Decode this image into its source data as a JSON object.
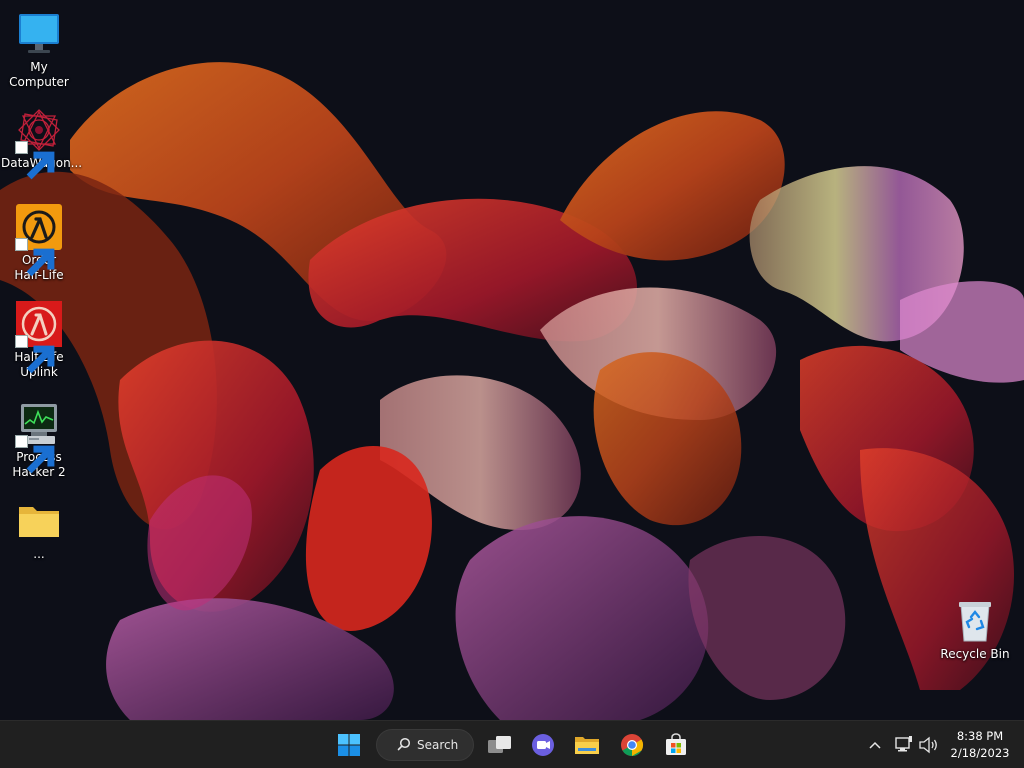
{
  "desktop": {
    "icons": [
      {
        "label": "My Computer",
        "icon": "monitor-icon"
      },
      {
        "label": "DataWagon...",
        "icon": "datawagon-icon",
        "shortcut": true
      },
      {
        "label": "Order\nHalf-Life",
        "icon": "half-life-orange-icon",
        "shortcut": true
      },
      {
        "label": "Half-Life\nUplink",
        "icon": "half-life-red-icon",
        "shortcut": true
      },
      {
        "label": "Process\nHacker 2",
        "icon": "process-hacker-icon",
        "shortcut": true
      },
      {
        "label": "...",
        "icon": "folder-icon"
      },
      {
        "label": "Recycle Bin",
        "icon": "recycle-bin-icon"
      }
    ]
  },
  "taskbar": {
    "search_label": "Search",
    "apps": [
      "start-icon",
      "search-icon",
      "task-view-icon",
      "teams-chat-icon",
      "file-explorer-icon",
      "chrome-icon",
      "microsoft-store-icon"
    ],
    "tray": [
      "show-hidden-icons-chevron",
      "network-icon",
      "volume-icon"
    ],
    "clock": {
      "time": "8:38 PM",
      "date": "2/18/2023"
    }
  },
  "colors": {
    "taskbar_bg": "#202020",
    "desktop_bg": "#0d0f18",
    "accent": "#0078d4"
  }
}
